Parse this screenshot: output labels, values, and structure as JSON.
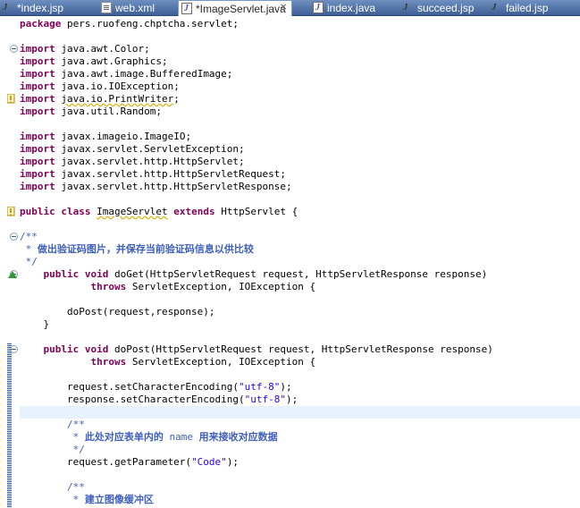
{
  "tabs": [
    {
      "label": "*index.jsp",
      "icon": "jsp-file-icon",
      "active": false
    },
    {
      "label": "web.xml",
      "icon": "xml-file-icon",
      "active": false
    },
    {
      "label": "*ImageServlet.java",
      "icon": "java-file-icon",
      "active": true
    },
    {
      "label": "index.java",
      "icon": "java-file-icon",
      "active": false
    },
    {
      "label": "succeed.jsp",
      "icon": "jsp-file-icon",
      "active": false
    },
    {
      "label": "failed.jsp",
      "icon": "jsp-file-icon",
      "active": false
    }
  ],
  "close_glyph": "✕",
  "editor": {
    "lines": [
      [
        {
          "t": "package",
          "c": "kw"
        },
        {
          "t": " pers.ruofeng.chptcha.servlet;"
        }
      ],
      [],
      [
        {
          "t": "import",
          "c": "kw"
        },
        {
          "t": " java.awt.Color;"
        }
      ],
      [
        {
          "t": "import",
          "c": "kw"
        },
        {
          "t": " java.awt.Graphics;"
        }
      ],
      [
        {
          "t": "import",
          "c": "kw"
        },
        {
          "t": " java.awt.image.BufferedImage;"
        }
      ],
      [
        {
          "t": "import",
          "c": "kw"
        },
        {
          "t": " java.io.IOException;"
        }
      ],
      [
        {
          "t": "import",
          "c": "kw"
        },
        {
          "t": " "
        },
        {
          "t": "java.io.PrintWriter",
          "c": "warnline"
        },
        {
          "t": ";"
        }
      ],
      [
        {
          "t": "import",
          "c": "kw"
        },
        {
          "t": " java.util.Random;"
        }
      ],
      [],
      [
        {
          "t": "import",
          "c": "kw"
        },
        {
          "t": " javax.imageio.ImageIO;"
        }
      ],
      [
        {
          "t": "import",
          "c": "kw"
        },
        {
          "t": " javax.servlet.ServletException;"
        }
      ],
      [
        {
          "t": "import",
          "c": "kw"
        },
        {
          "t": " javax.servlet.http.HttpServlet;"
        }
      ],
      [
        {
          "t": "import",
          "c": "kw"
        },
        {
          "t": " javax.servlet.http.HttpServletRequest;"
        }
      ],
      [
        {
          "t": "import",
          "c": "kw"
        },
        {
          "t": " javax.servlet.http.HttpServletResponse;"
        }
      ],
      [],
      [
        {
          "t": "public class",
          "c": "kw"
        },
        {
          "t": " "
        },
        {
          "t": "ImageServlet",
          "c": "warnline"
        },
        {
          "t": " "
        },
        {
          "t": "extends",
          "c": "kw"
        },
        {
          "t": " HttpServlet {"
        }
      ],
      [],
      [
        {
          "t": "/**",
          "c": "doc"
        }
      ],
      [
        {
          "t": " * ",
          "c": "doc"
        },
        {
          "t": "做出验证码图片，并保存当前验证码信息以供比较",
          "c": "cn"
        }
      ],
      [
        {
          "t": " */",
          "c": "doc"
        }
      ],
      [
        {
          "t": "    "
        },
        {
          "t": "public void",
          "c": "kw"
        },
        {
          "t": " doGet(HttpServletRequest request, HttpServletResponse response)"
        }
      ],
      [
        {
          "t": "            "
        },
        {
          "t": "throws",
          "c": "kw"
        },
        {
          "t": " ServletException, IOException {"
        }
      ],
      [],
      [
        {
          "t": "        doPost(request,response);"
        }
      ],
      [
        {
          "t": "    }"
        }
      ],
      [],
      [
        {
          "t": "    "
        },
        {
          "t": "public void",
          "c": "kw"
        },
        {
          "t": " doPost(HttpServletRequest request, HttpServletResponse response)"
        }
      ],
      [
        {
          "t": "            "
        },
        {
          "t": "throws",
          "c": "kw"
        },
        {
          "t": " ServletException, IOException {"
        }
      ],
      [],
      [
        {
          "t": "        request.setCharacterEncoding("
        },
        {
          "t": "\"utf-8\"",
          "c": "str"
        },
        {
          "t": ");"
        }
      ],
      [
        {
          "t": "        response.setCharacterEncoding("
        },
        {
          "t": "\"utf-8\"",
          "c": "str"
        },
        {
          "t": ");"
        }
      ],
      [],
      [
        {
          "t": "        /**",
          "c": "doc"
        }
      ],
      [
        {
          "t": "         * ",
          "c": "doc"
        },
        {
          "t": "此处对应表单内的",
          "c": "cn"
        },
        {
          "t": " name ",
          "c": "doc"
        },
        {
          "t": "用来接收对应数据",
          "c": "cn"
        }
      ],
      [
        {
          "t": "         */",
          "c": "doc"
        }
      ],
      [
        {
          "t": "        request.getParameter("
        },
        {
          "t": "\"Code\"",
          "c": "str"
        },
        {
          "t": ");"
        }
      ],
      [],
      [
        {
          "t": "        /**",
          "c": "doc"
        }
      ],
      [
        {
          "t": "         * ",
          "c": "doc"
        },
        {
          "t": "建立图像缓冲区",
          "c": "cn"
        }
      ]
    ]
  }
}
